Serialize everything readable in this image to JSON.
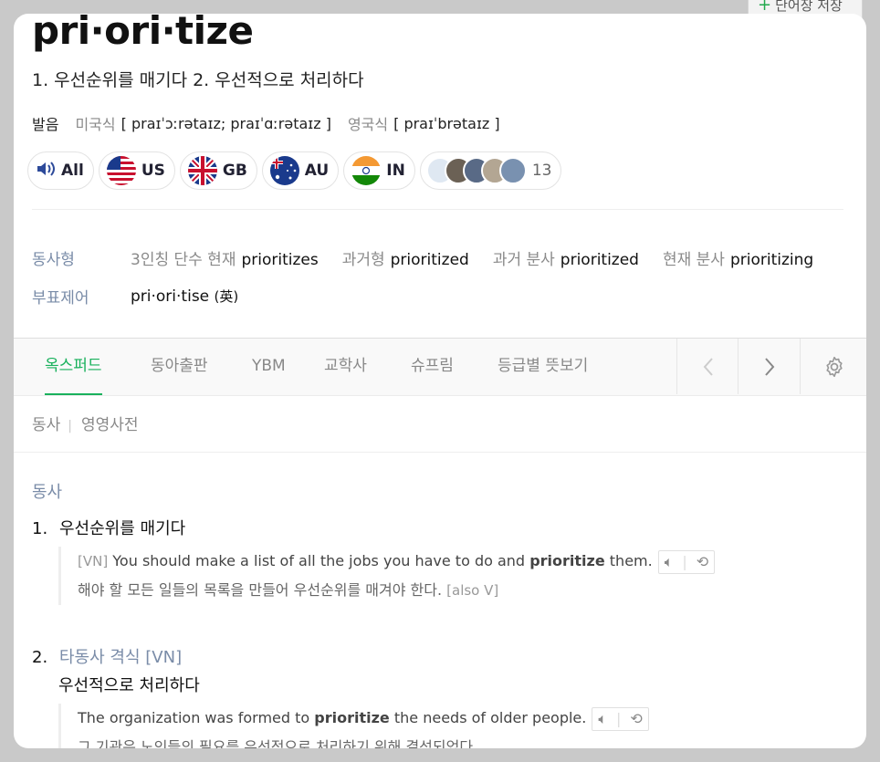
{
  "save_word": {
    "label": "단어장 저장"
  },
  "entry": {
    "headword": "pri·ori·tize",
    "meaning_line": "1. 우선순위를 매기다 2. 우선적으로 처리하다",
    "pron_label": "발음",
    "us_region": "미국식",
    "us_ipa": "[ praɪˈɔːrətaɪz; praɪˈɑːrətaɪz ]",
    "uk_region": "영국식",
    "uk_ipa": "[ praɪˈbrətaɪz ]"
  },
  "audio_buttons": [
    {
      "label": "All",
      "icon": "speaker-icon"
    },
    {
      "label": "US",
      "icon": "us-flag-icon"
    },
    {
      "label": "GB",
      "icon": "gb-flag-icon"
    },
    {
      "label": "AU",
      "icon": "au-flag-icon"
    },
    {
      "label": "IN",
      "icon": "in-flag-icon"
    }
  ],
  "user_recordings": {
    "count": "13"
  },
  "forms": {
    "verb_label": "동사형",
    "third_label": "3인칭 단수 현재",
    "third_value": "prioritizes",
    "past_label": "과거형",
    "past_value": "prioritized",
    "pp_label": "과거 분사",
    "pp_value": "prioritized",
    "presp_label": "현재 분사",
    "presp_value": "prioritizing",
    "variant_label": "부표제어",
    "variant_value": "pri·ori·tise",
    "variant_tag": "(英)"
  },
  "tabs": [
    "옥스퍼드",
    "동아출판",
    "YBM",
    "교학사",
    "슈프림",
    "등급별 뜻보기"
  ],
  "subtabs": [
    "동사",
    "영영사전"
  ],
  "colors": {
    "accent": "#19b15c",
    "pos": "#7a8ca8"
  },
  "definitions": {
    "pos": "동사",
    "sense1": {
      "num": "1.",
      "meaning": "우선순위를 매기다",
      "ex_code": "[VN]",
      "ex_pre": "You should make a list of all the jobs you have to do and",
      "ex_bold": "prioritize",
      "ex_post": "them.",
      "ex_ko": "해야 할 모든 일들의 목록을 만들어 우선순위를 매겨야 한다.",
      "ex_ko_code": "[also V]"
    },
    "sense2": {
      "num": "2.",
      "link1": "타동사",
      "link2": "격식",
      "gram": "[VN]",
      "meaning": "우선적으로 처리하다",
      "ex_pre": "The organization was formed to",
      "ex_bold": "prioritize",
      "ex_post": "the needs of older people.",
      "ex_ko": "그 기관은 노인들의 필요를 우선적으로 처리하기 위해 결성되었다."
    }
  }
}
